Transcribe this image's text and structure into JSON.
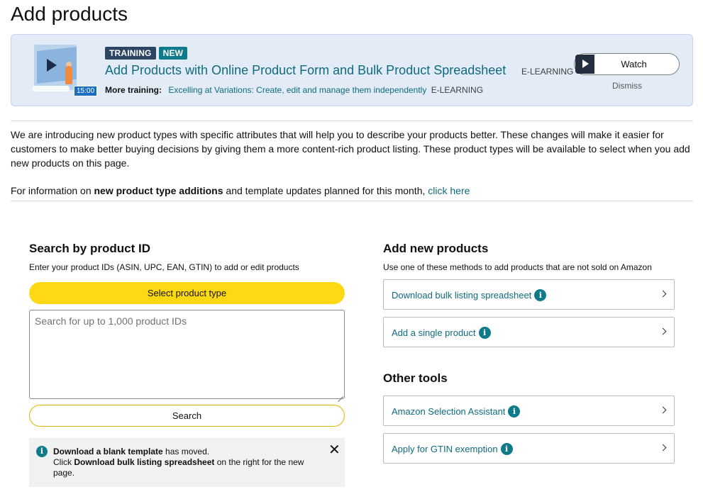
{
  "page": {
    "title": "Add products"
  },
  "banner": {
    "thumb_time": "15:00",
    "badges": [
      "TRAINING",
      "NEW"
    ],
    "title": "Add Products with Online Product Form and Bulk Product Spreadsheet",
    "title_tag": "E-LEARNING",
    "more_label": "More training:",
    "more_link": "Excelling at Variations: Create, edit and manage them independently",
    "more_tag": "E-LEARNING",
    "watch_label": "Watch",
    "dismiss_label": "Dismiss"
  },
  "info": {
    "paragraph": "We are introducing new product types with specific attributes that will help you to describe your products better. These changes will make it easier for customers to make better buying decisions by giving them a more content-rich product listing. These product types will be available to select when you add new products on this page.",
    "line_prefix": "For information on ",
    "line_bold": "new product type additions",
    "line_middle": " and template updates planned for this month, ",
    "line_link": "click here"
  },
  "search_section": {
    "title": "Search by product ID",
    "subtitle": "Enter your product IDs (ASIN, UPC, EAN, GTIN) to add or edit products",
    "select_button": "Select product type",
    "textarea_placeholder": "Search for up to 1,000 product IDs",
    "search_button": "Search"
  },
  "notice": {
    "bold1": "Download a blank template",
    "text1": " has moved.",
    "text2": "Click ",
    "bold2": "Download bulk listing spreadsheet",
    "text3": " on the right for the new page.",
    "close": "✕"
  },
  "add_section": {
    "title": "Add new products",
    "subtitle": "Use one of these methods to add products that are not sold on Amazon",
    "items": [
      {
        "label": "Download bulk listing spreadsheet"
      },
      {
        "label": "Add a single product"
      }
    ]
  },
  "tools_section": {
    "title": "Other tools",
    "items": [
      {
        "label": "Amazon Selection Assistant"
      },
      {
        "label": "Apply for GTIN exemption"
      }
    ]
  },
  "icons": {
    "info": "i",
    "colors": {
      "accent_yellow": "#ffd814",
      "link_teal": "#0f6b7f",
      "badge_navy": "#2b4563",
      "badge_teal": "#0f7b8a",
      "banner_bg": "#e3ebf6"
    }
  }
}
